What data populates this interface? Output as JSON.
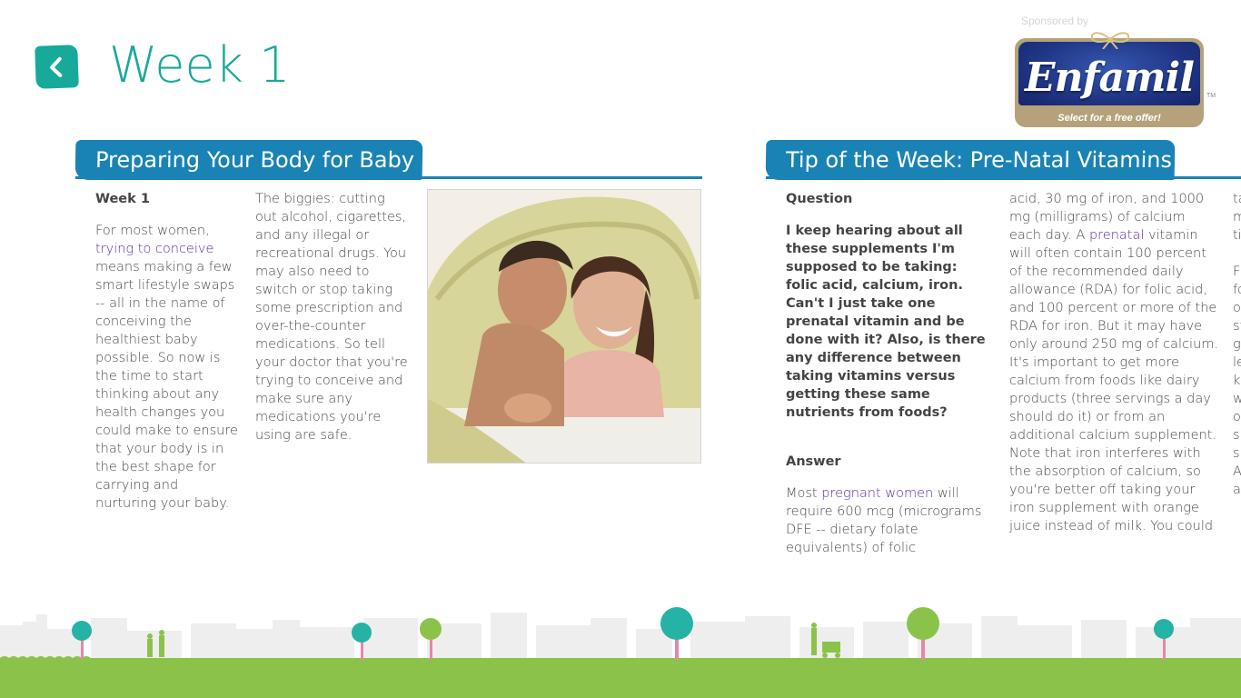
{
  "header": {
    "title": "Week 1"
  },
  "sponsor": {
    "label": "Sponsored by",
    "brand": "Enfamil",
    "tagline": "Select for a free offer!",
    "trademark": "TM",
    "colors": {
      "badge": "#1f3584",
      "trim": "#b5a27a"
    }
  },
  "sections": {
    "preparing": {
      "title": "Preparing Your Body for Baby",
      "subheading": "Week 1",
      "p1_before": "For most women, ",
      "p1_link": "trying to conceive",
      "p1_after": " means making a few smart lifestyle swaps -- all in the name of conceiving the healthiest baby possible. So now is the time to start thinking about any health changes you could make to ensure that your body is in the best shape for carrying and nurturing your baby.",
      "p2": "The biggies: cutting out alcohol, cigarettes, and any illegal or recreational drugs. You may also need to switch or stop taking some prescription and over-the-counter medications. So tell your doctor that you're trying to conceive and make sure any medications you're using are safe."
    },
    "tip": {
      "title": "Tip of the Week: Pre-Natal Vitamins",
      "question_label": "Question",
      "question": "I keep hearing about all these supplements I'm supposed to be taking: folic acid, calcium, iron. Can't I just take one prenatal vitamin and be done with it? Also, is there any difference between taking vitamins versus getting these same nutrients from foods?",
      "answer_label": "Answer",
      "a1_before": "Most ",
      "a1_link": "pregnant women",
      "a1_after": " will require 600 mcg (micrograms DFE -- dietary folate equivalents) of folic",
      "a2_before": "acid, 30 mg of iron, and 1000 mg (milligrams) of calcium each day. A ",
      "a2_link": "prenatal",
      "a2_after": " vitamin will often contain 100 percent of the recommended daily allowance (RDA) for folic acid, and 100 percent or more of the RDA for iron. But it may have only around 250 mg of calcium. It's important to get more calcium from foods like dairy products (three servings a day should do it) or from an additional calcium supplement. Note that iron interferes with the absorption of calcium, so you're better off taking your iron supplement with orange juice instead of milk. You could",
      "col3_lines": [
        "ta",
        "m",
        "ti",
        "",
        "F",
        "fc",
        "o",
        "st",
        "g",
        "le",
        "k",
        "w",
        "o",
        "su",
        "su",
        "A",
        "a"
      ]
    }
  },
  "colors": {
    "accent": "#17a99a",
    "banner": "#1a83b5",
    "link": "#5b2aa6",
    "grass": "#8bc34a"
  }
}
